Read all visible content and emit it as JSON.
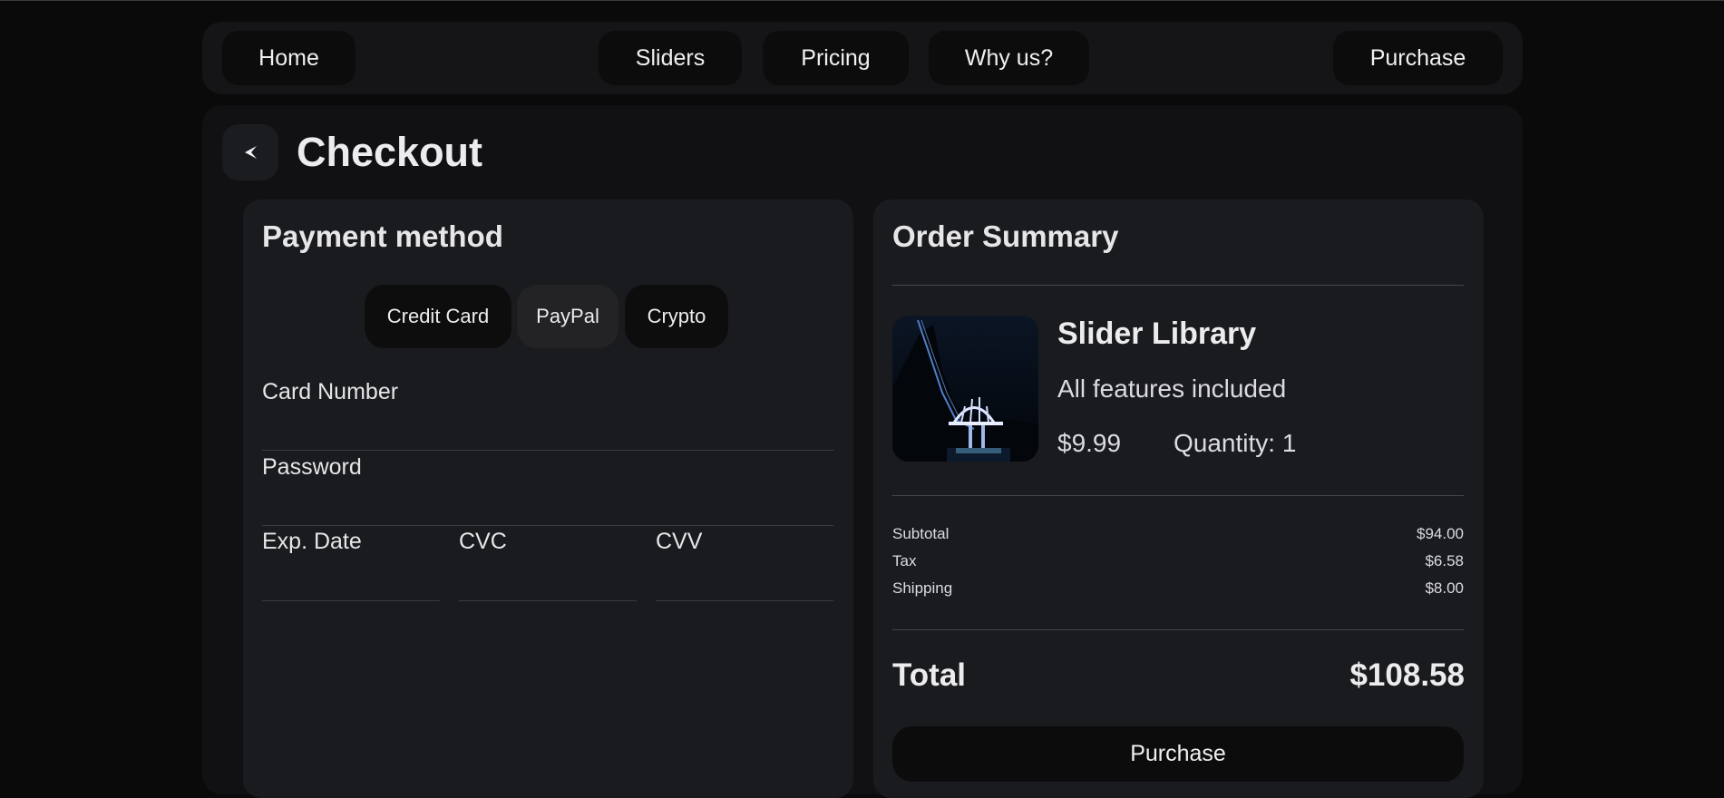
{
  "nav": {
    "home": "Home",
    "sliders": "Sliders",
    "pricing": "Pricing",
    "why_us": "Why us?",
    "purchase": "Purchase"
  },
  "page": {
    "title": "Checkout",
    "back_icon": "chevron-left-icon"
  },
  "payment": {
    "title": "Payment method",
    "tabs": [
      "Credit Card",
      "PayPal",
      "Crypto"
    ],
    "selected_tab": "PayPal",
    "fields": {
      "card_number": "Card Number",
      "password": "Password",
      "exp_date": "Exp. Date",
      "cvc": "CVC",
      "cvv": "CVV"
    }
  },
  "summary": {
    "title": "Order Summary",
    "product": {
      "name": "Slider Library",
      "description": "All features included",
      "price": "$9.99",
      "quantity": "Quantity: 1"
    },
    "lines": [
      {
        "label": "Subtotal",
        "value": "$94.00"
      },
      {
        "label": "Tax",
        "value": "$6.58"
      },
      {
        "label": "Shipping",
        "value": "$8.00"
      }
    ],
    "total_label": "Total",
    "total_value": "$108.58",
    "purchase_label": "Purchase"
  },
  "colors": {
    "background": "#0a0a0a",
    "panel": "#111113",
    "card": "#1a1b1f",
    "button": "#0c0c0d",
    "selected_tab": "#232325"
  }
}
